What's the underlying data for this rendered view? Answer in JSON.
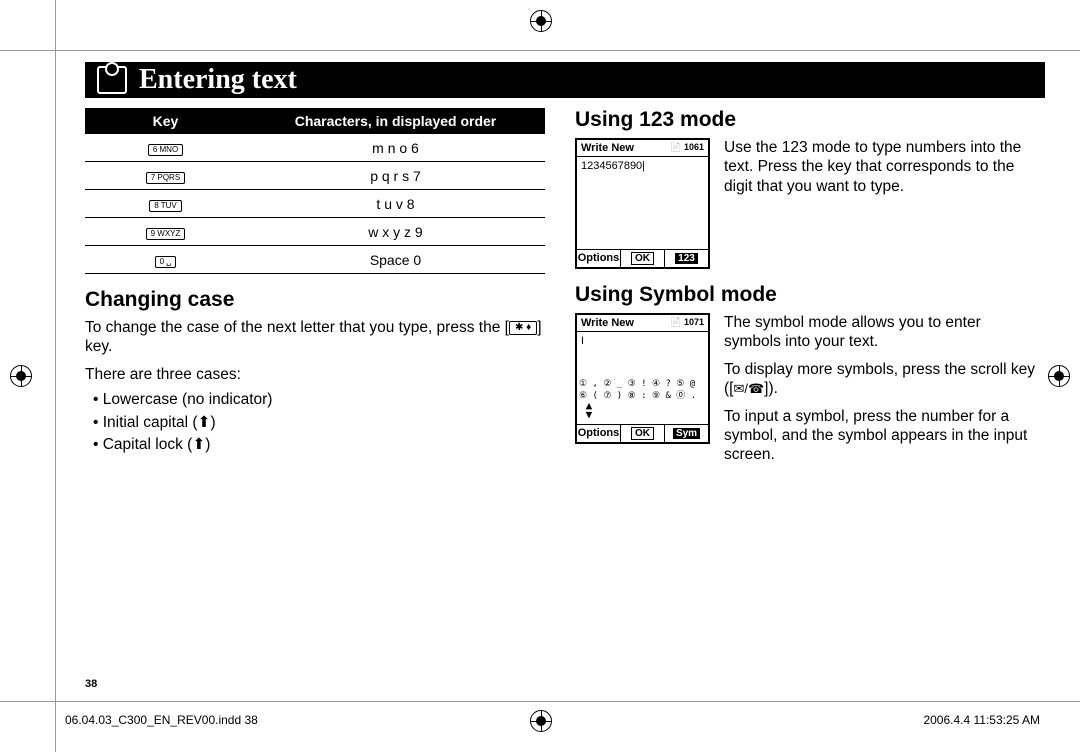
{
  "title": "Entering text",
  "table": {
    "header_key": "Key",
    "header_chars": "Characters, in displayed order",
    "rows": [
      {
        "key": "6 MNO",
        "chars": "m   n   o   6"
      },
      {
        "key": "7 PQRS",
        "chars": "p   q   r   s   7"
      },
      {
        "key": "8 TUV",
        "chars": "t   u   v   8"
      },
      {
        "key": "9 WXYZ",
        "chars": "w   x   y   z   9"
      },
      {
        "key": "0  ␣",
        "chars": "Space 0"
      }
    ]
  },
  "changing_case": {
    "heading": "Changing case",
    "para1_a": "To change the case of the next letter that you type, press the [",
    "para1_key": "✱ ♦",
    "para1_b": "] key.",
    "para2": "There are three cases:",
    "items": [
      "Lowercase (no indicator)",
      "Initial capital (⬆)",
      "Capital lock (⬆)"
    ]
  },
  "mode123": {
    "heading": "Using 123 mode",
    "screen": {
      "title": "Write New",
      "count": "1061",
      "body": "1234567890|",
      "footer_left": "Options",
      "footer_mid": "OK",
      "footer_right": "123"
    },
    "text": "Use the 123 mode to type numbers into the text. Press the key that corresponds to the digit that you want to type."
  },
  "modeSymbol": {
    "heading": "Using Symbol mode",
    "screen": {
      "title": "Write New",
      "count": "1071",
      "body": "I",
      "sym_row1": "① , ② _ ③ ! ④ ? ⑤ @",
      "sym_row2": "⑥ ( ⑦ ) ⑧ : ⑨ & ⓪ .",
      "footer_left": "Options",
      "footer_mid": "OK",
      "footer_right": "Sym"
    },
    "text1": "The symbol mode allows you to enter symbols into your text.",
    "text2_a": "To display more symbols, press the scroll key ([",
    "text2_keys": "✉/☎",
    "text2_b": "]).",
    "text3": "To input a symbol, press the number for a symbol, and the symbol appears in the input screen."
  },
  "page_number": "38",
  "footer_file": "06.04.03_C300_EN_REV00.indd   38",
  "footer_date": "2006.4.4   11:53:25 AM"
}
